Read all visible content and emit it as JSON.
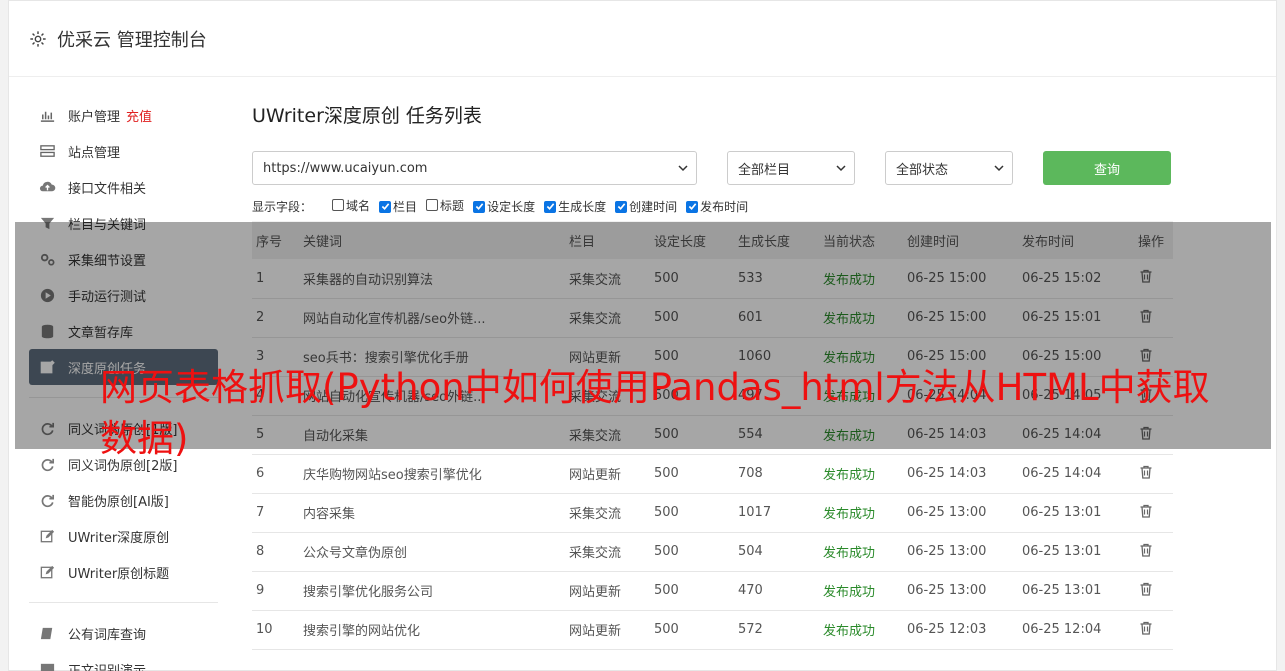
{
  "header": {
    "title": "优采云 管理控制台"
  },
  "sidebar": {
    "group1": [
      {
        "label": "账户管理",
        "badge": "充值",
        "icon": "bar-chart-icon"
      },
      {
        "label": "站点管理",
        "icon": "server-icon"
      },
      {
        "label": "接口文件相关",
        "icon": "cloud-upload-icon"
      },
      {
        "label": "栏目与关键词",
        "icon": "filter-icon"
      },
      {
        "label": "采集细节设置",
        "icon": "gears-icon"
      },
      {
        "label": "手动运行测试",
        "icon": "play-circle-icon"
      },
      {
        "label": "文章暂存库",
        "icon": "database-icon"
      },
      {
        "label": "深度原创任务",
        "icon": "edit-icon",
        "active": true
      }
    ],
    "group2": [
      {
        "label": "同义词伪原创[1版]",
        "icon": "refresh-icon"
      },
      {
        "label": "同义词伪原创[2版]",
        "icon": "refresh-icon"
      },
      {
        "label": "智能伪原创[AI版]",
        "icon": "refresh-icon"
      },
      {
        "label": "UWriter深度原创",
        "icon": "edit-icon"
      },
      {
        "label": "UWriter原创标题",
        "icon": "edit-icon"
      }
    ],
    "group3": [
      {
        "label": "公有词库查询",
        "icon": "book-icon"
      },
      {
        "label": "正文识别演示",
        "icon": "monitor-icon"
      }
    ]
  },
  "main": {
    "title": "UWriter深度原创 任务列表",
    "site_select": "https://www.ucaiyun.com",
    "column_select": "全部栏目",
    "status_select": "全部状态",
    "query_button": "查询",
    "fields_label": "显示字段：",
    "fields": [
      {
        "label": "域名",
        "checked": false
      },
      {
        "label": "栏目",
        "checked": true
      },
      {
        "label": "标题",
        "checked": false
      },
      {
        "label": "设定长度",
        "checked": true
      },
      {
        "label": "生成长度",
        "checked": true
      },
      {
        "label": "创建时间",
        "checked": true
      },
      {
        "label": "发布时间",
        "checked": true
      }
    ],
    "table": {
      "headers": [
        "序号",
        "关键词",
        "栏目",
        "设定长度",
        "生成长度",
        "当前状态",
        "创建时间",
        "发布时间",
        "操作"
      ],
      "rows": [
        [
          "1",
          "采集器的自动识别算法",
          "采集交流",
          "500",
          "533",
          "发布成功",
          "06-25 15:00",
          "06-25 15:02"
        ],
        [
          "2",
          "网站自动化宣传机器/seo外链...",
          "采集交流",
          "500",
          "601",
          "发布成功",
          "06-25 15:00",
          "06-25 15:01"
        ],
        [
          "3",
          "seo兵书：搜索引擎优化手册",
          "网站更新",
          "500",
          "1060",
          "发布成功",
          "06-25 15:00",
          "06-25 15:00"
        ],
        [
          "4",
          "网站自动化宣传机器/seo外链...",
          "采集交流",
          "500",
          "497",
          "发布成功",
          "06-25 14:04",
          "06-25 14:05"
        ],
        [
          "5",
          "自动化采集",
          "采集交流",
          "500",
          "554",
          "发布成功",
          "06-25 14:03",
          "06-25 14:04"
        ],
        [
          "6",
          "庆华购物网站seo搜索引擎优化",
          "网站更新",
          "500",
          "708",
          "发布成功",
          "06-25 14:03",
          "06-25 14:04"
        ],
        [
          "7",
          "内容采集",
          "采集交流",
          "500",
          "1017",
          "发布成功",
          "06-25 13:00",
          "06-25 13:01"
        ],
        [
          "8",
          "公众号文章伪原创",
          "采集交流",
          "500",
          "504",
          "发布成功",
          "06-25 13:00",
          "06-25 13:01"
        ],
        [
          "9",
          "搜索引擎优化服务公司",
          "网站更新",
          "500",
          "470",
          "发布成功",
          "06-25 13:00",
          "06-25 13:01"
        ],
        [
          "10",
          "搜索引擎的网站优化",
          "网站更新",
          "500",
          "572",
          "发布成功",
          "06-25 12:03",
          "06-25 12:04"
        ]
      ]
    }
  },
  "overlay": {
    "text": "网页表格抓取(Python中如何使用Pandas_html方法从HTML中获取数据)"
  }
}
